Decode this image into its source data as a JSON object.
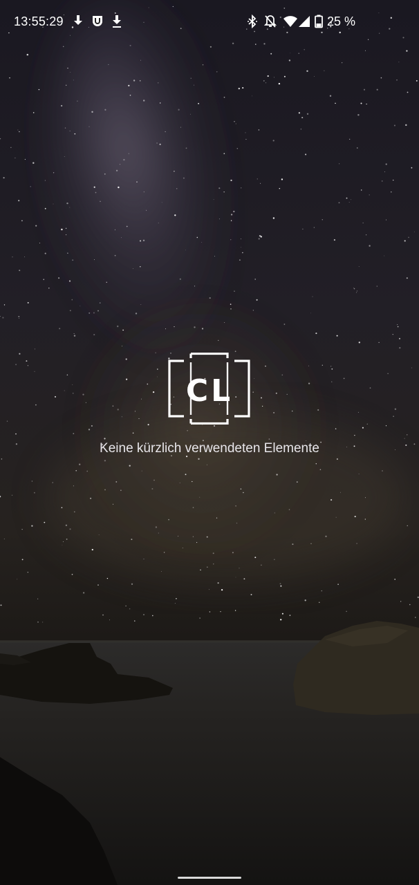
{
  "status_bar": {
    "time": "13:55:29",
    "left_icons": [
      "download-icon",
      "app-notification-icon",
      "download-done-icon"
    ],
    "right_icons": [
      "bluetooth-icon",
      "notifications-off-icon",
      "wifi-icon",
      "cellular-signal-icon",
      "battery-icon"
    ],
    "battery_percent": "25 %"
  },
  "app_logo": {
    "letters": "CL"
  },
  "empty_state": {
    "message": "Keine kürzlich verwendeten Elemente"
  },
  "colors": {
    "text": "#ffffff",
    "message": "#e8e6ea"
  }
}
